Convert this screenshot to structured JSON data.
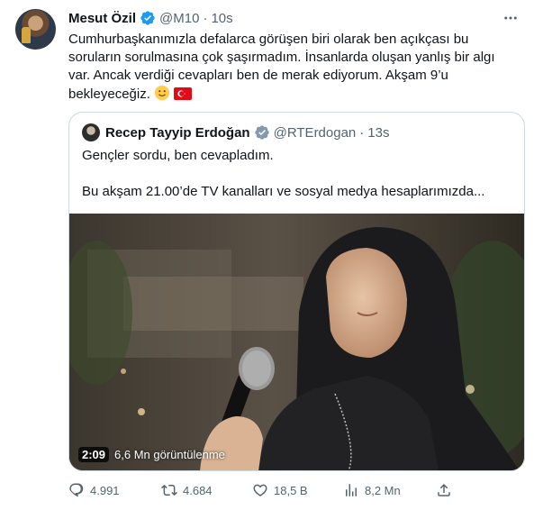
{
  "tweet": {
    "author_name": "Mesut Özil",
    "handle": "@M10",
    "time": "10s",
    "text": "Cumhurbaşkanımızla defalarca görüşen biri olarak ben açıkçası bu soruların sorulmasına çok şaşırmadım. İnsanlarda oluşan yanlış bir algı var. Ancak verdiği cevapları ben de merak ediyorum. Akşam 9’u bekleyeceğiz.",
    "emojis": [
      "slightly-smiling-face",
      "turkey-flag"
    ]
  },
  "quote": {
    "author_name": "Recep Tayyip Erdoğan",
    "handle": "@RTErdogan",
    "time": "13s",
    "line1": "Gençler sordu, ben cevapladım.",
    "line2": "Bu akşam 21.00’de TV kanalları ve sosyal medya hesaplarımızda...",
    "video": {
      "duration": "2:09",
      "views": "6,6 Mn görüntülenme"
    }
  },
  "actions": {
    "replies": "4.991",
    "retweets": "4.684",
    "likes": "18,5 B",
    "views": "8,2 Mn"
  },
  "colors": {
    "verified": "#1d9bf0",
    "secondary_text": "#536471",
    "border": "#cfd9de",
    "flag_red": "#e30a17"
  },
  "icons": [
    "verified-badge-icon",
    "more-options-icon",
    "reply-icon",
    "retweet-icon",
    "like-icon",
    "views-icon",
    "share-icon"
  ]
}
